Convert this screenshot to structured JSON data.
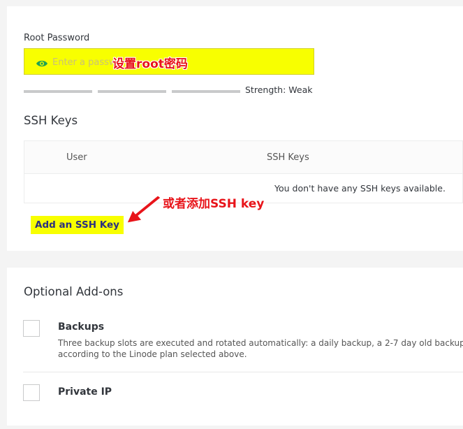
{
  "root_password": {
    "label": "Root Password",
    "placeholder": "Enter a password.",
    "annotation": "设置root密码",
    "strength_text": "Strength: Weak"
  },
  "ssh_keys": {
    "title": "SSH Keys",
    "col_user": "User",
    "col_keys": "SSH Keys",
    "empty_message": "You don't have any SSH keys available.",
    "add_button": "Add an SSH Key",
    "annotation": "或者添加SSH key"
  },
  "addons": {
    "title": "Optional Add-ons",
    "backups": {
      "label": "Backups",
      "desc_line1": "Three backup slots are executed and rotated automatically: a daily backup, a 2-7 day old backup,",
      "desc_line2": "according to the Linode plan selected above."
    },
    "private_ip": {
      "label": "Private IP"
    }
  },
  "colors": {
    "highlight": "#f8ff00",
    "annotation": "#e8141a",
    "accent_green": "#1fa254",
    "link": "#2b2f80"
  }
}
